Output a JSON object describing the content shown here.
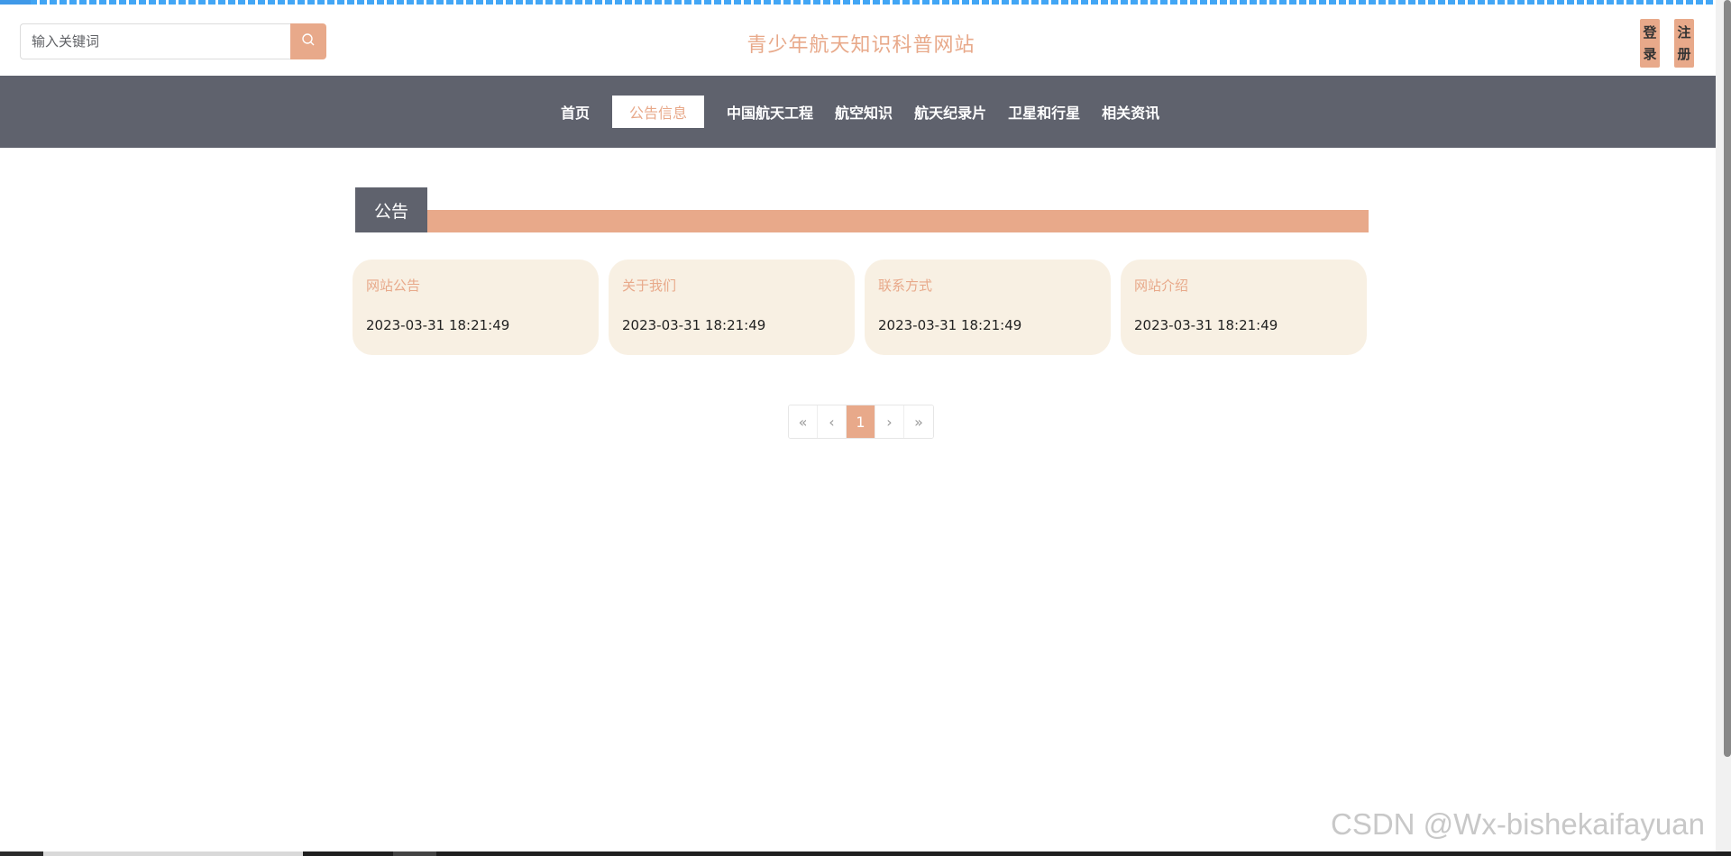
{
  "header": {
    "search_placeholder": "输入关键词",
    "site_title": "青少年航天知识科普网站",
    "login_label": "登录",
    "register_label": "注册"
  },
  "nav": {
    "items": [
      {
        "label": "首页",
        "active": false
      },
      {
        "label": "公告信息",
        "active": true
      },
      {
        "label": "中国航天工程",
        "active": false
      },
      {
        "label": "航空知识",
        "active": false
      },
      {
        "label": "航天纪录片",
        "active": false
      },
      {
        "label": "卫星和行星",
        "active": false
      },
      {
        "label": "相关资讯",
        "active": false
      }
    ]
  },
  "section": {
    "title": "公告"
  },
  "cards": [
    {
      "title": "网站公告",
      "date": "2023-03-31 18:21:49"
    },
    {
      "title": "关于我们",
      "date": "2023-03-31 18:21:49"
    },
    {
      "title": "联系方式",
      "date": "2023-03-31 18:21:49"
    },
    {
      "title": "网站介绍",
      "date": "2023-03-31 18:21:49"
    }
  ],
  "pagination": {
    "first": "«",
    "prev": "‹",
    "current": "1",
    "next": "›",
    "last": "»"
  },
  "watermark": "CSDN @Wx-bishekaifayuan",
  "colors": {
    "accent": "#e8a98a",
    "nav_bg": "#5f626d",
    "card_bg": "#f8f0e3"
  }
}
